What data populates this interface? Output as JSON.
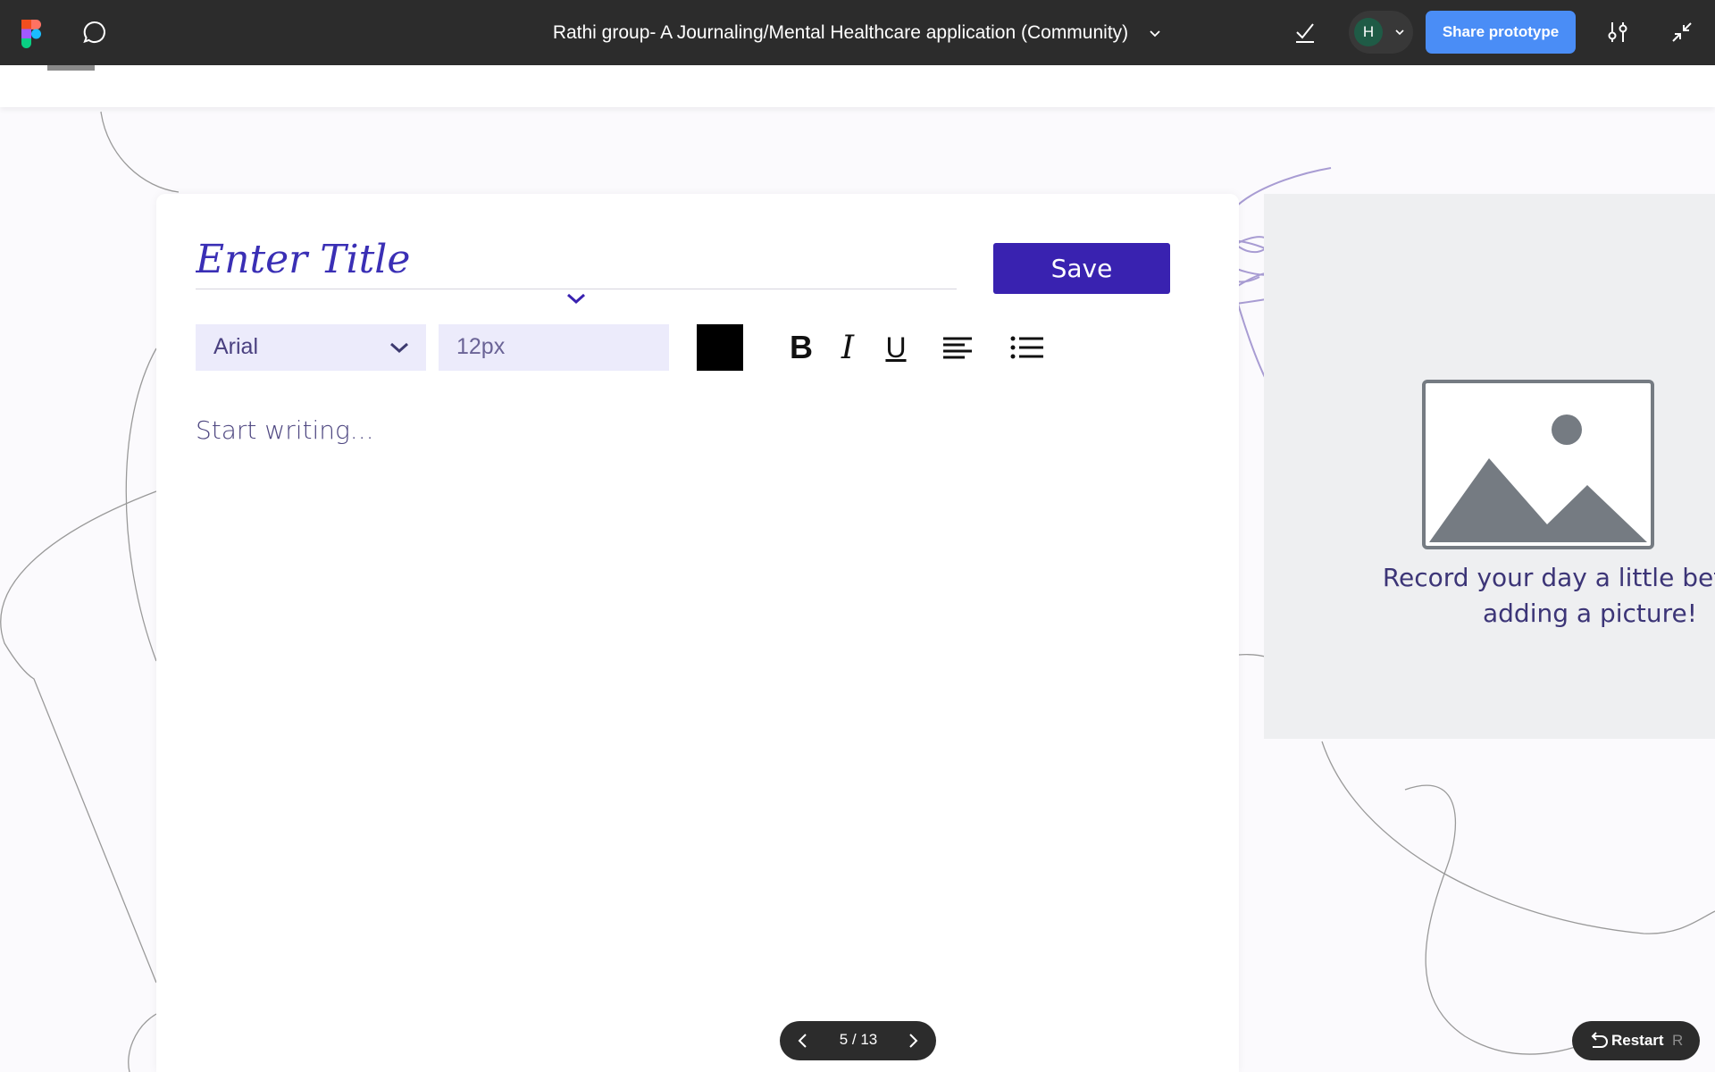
{
  "toolbar": {
    "document_title": "Rathi group- A Journaling/Mental Healthcare application (Community)",
    "avatar_initial": "H",
    "share_label": "Share prototype",
    "colors": {
      "background": "#2c2c2c",
      "share_button": "#4a8df6",
      "avatar": "#1f5b46"
    },
    "icons": [
      "figma-logo-icon",
      "comment-icon",
      "chevron-down-icon",
      "checkmark-icon",
      "settings-sliders-icon",
      "collapse-icon"
    ]
  },
  "editor": {
    "title_placeholder": "Enter Title",
    "save_label": "Save",
    "font_family": "Arial",
    "font_size": "12px",
    "text_color": "#000000",
    "format_buttons": {
      "bold": "B",
      "italic": "I",
      "underline": "U"
    },
    "body_placeholder": "Start writing...",
    "colors": {
      "accent": "#3922b0",
      "title": "#3a2fb5",
      "field_background": "#ecebfb"
    }
  },
  "image_panel": {
    "caption_line1": "Record your day a little better by",
    "caption_line2": "adding a picture!",
    "icon": "image-placeholder-icon"
  },
  "prototype_nav": {
    "page_indicator": "5 / 13",
    "restart_label": "Restart",
    "restart_shortcut": "R"
  }
}
